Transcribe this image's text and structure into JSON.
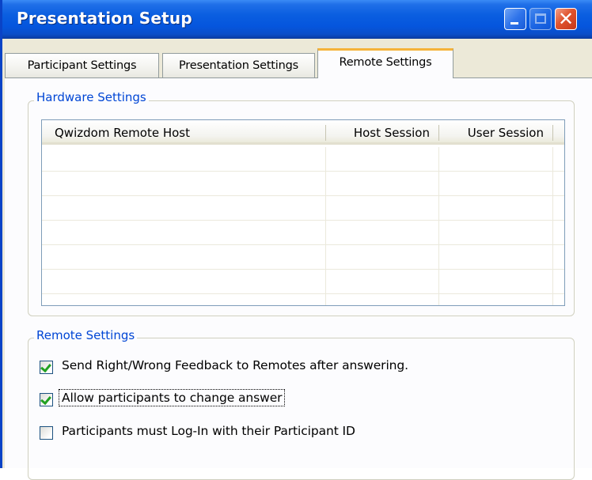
{
  "window": {
    "title": "Presentation Setup",
    "controls": {
      "minimize": "minimize",
      "maximize": "maximize",
      "close": "close"
    }
  },
  "tabs": [
    {
      "label": "Participant Settings",
      "active": false
    },
    {
      "label": "Presentation Settings",
      "active": false
    },
    {
      "label": "Remote Settings",
      "active": true
    }
  ],
  "hardware_settings": {
    "legend": "Hardware Settings",
    "columns": [
      "Qwizdom Remote Host",
      "Host Session",
      "User Session"
    ],
    "rows": []
  },
  "remote_settings": {
    "legend": "Remote Settings",
    "options": [
      {
        "label": "Send Right/Wrong Feedback to Remotes after answering.",
        "checked": true
      },
      {
        "label": "Allow participants to change answer",
        "checked": true,
        "focused": true
      },
      {
        "label": "Participants must Log-In with their Participant ID",
        "checked": false
      }
    ]
  },
  "colors": {
    "titlebar": "#0555dd",
    "group_legend": "#0046d5",
    "active_tab_highlight": "#f5b33b",
    "checkmark": "#21a121",
    "close_button": "#e0532d"
  }
}
